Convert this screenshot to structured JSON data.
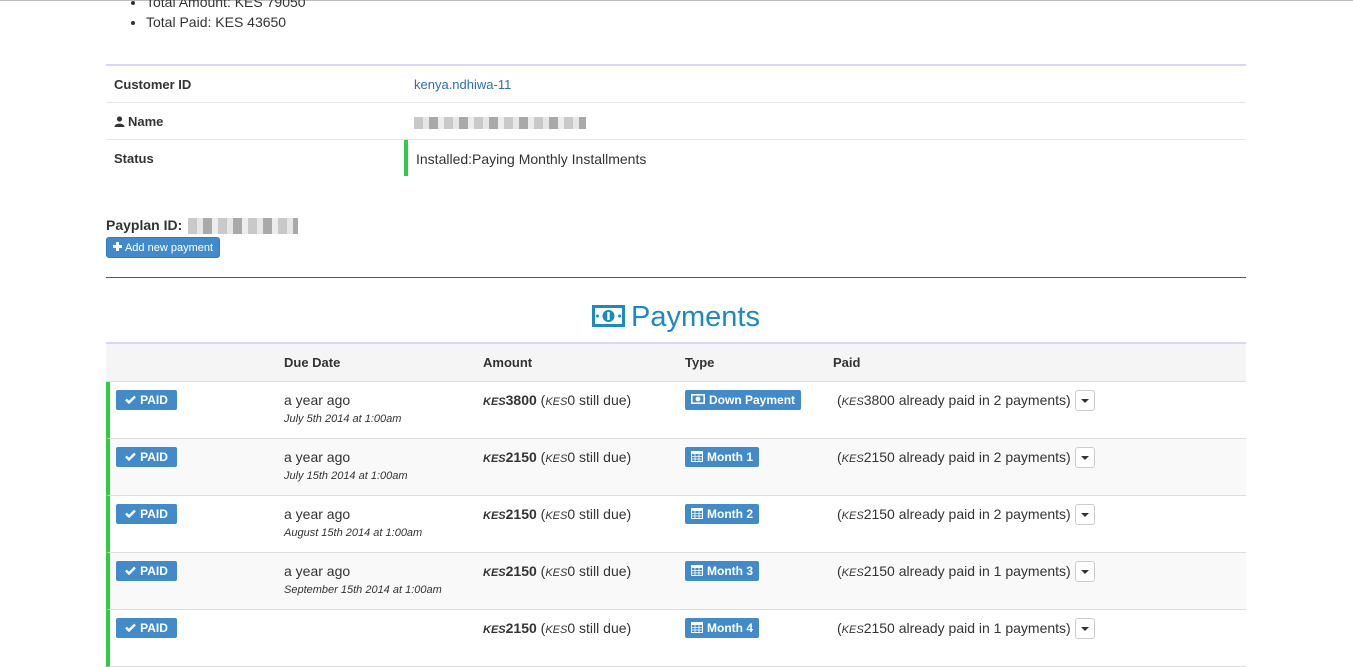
{
  "summary": {
    "total_amount": "Total Amount: KES 79050",
    "total_paid": "Total Paid: KES 43650"
  },
  "customer": {
    "id_label": "Customer ID",
    "id_value": "kenya.ndhiwa-11",
    "name_label": "Name",
    "status_label": "Status",
    "status_value": "Installed:Paying Monthly Installments"
  },
  "payplan": {
    "label": "Payplan ID:",
    "add_button": "Add new payment"
  },
  "payments_heading": "Payments",
  "table": {
    "headers": [
      "Due Date",
      "Amount",
      "Type",
      "Paid"
    ],
    "currency": "KES",
    "rows": [
      {
        "status": "PAID",
        "due_relative": "a year ago",
        "due_absolute": "July 5th 2014 at 1:00am",
        "amount": "3800",
        "due": "0",
        "due_suffix": "still due)",
        "type": "Down Payment",
        "type_icon": "money-icon",
        "paid_amount": "3800",
        "paid_suffix": "already paid in 2 payments)"
      },
      {
        "status": "PAID",
        "due_relative": "a year ago",
        "due_absolute": "July 15th 2014 at 1:00am",
        "amount": "2150",
        "due": "0",
        "due_suffix": "still due)",
        "type": "Month 1",
        "type_icon": "calendar-icon",
        "paid_amount": "2150",
        "paid_suffix": "already paid in 2 payments)"
      },
      {
        "status": "PAID",
        "due_relative": "a year ago",
        "due_absolute": "August 15th 2014 at 1:00am",
        "amount": "2150",
        "due": "0",
        "due_suffix": "still due)",
        "type": "Month 2",
        "type_icon": "calendar-icon",
        "paid_amount": "2150",
        "paid_suffix": "already paid in 2 payments)"
      },
      {
        "status": "PAID",
        "due_relative": "a year ago",
        "due_absolute": "September 15th 2014 at 1:00am",
        "amount": "2150",
        "due": "0",
        "due_suffix": "still due)",
        "type": "Month 3",
        "type_icon": "calendar-icon",
        "paid_amount": "2150",
        "paid_suffix": "already paid in 1 payments)"
      },
      {
        "status": "PAID",
        "due_relative": "",
        "due_absolute": "",
        "amount": "2150",
        "due": "0",
        "due_suffix": "still due)",
        "type": "Month 4",
        "type_icon": "calendar-icon",
        "paid_amount": "2150",
        "paid_suffix": "already paid in 1 payments)"
      }
    ]
  },
  "colors": {
    "primary": "#428bca",
    "success": "#2ecc40",
    "heading": "#1a8ac6",
    "link": "#2a6fb8"
  }
}
